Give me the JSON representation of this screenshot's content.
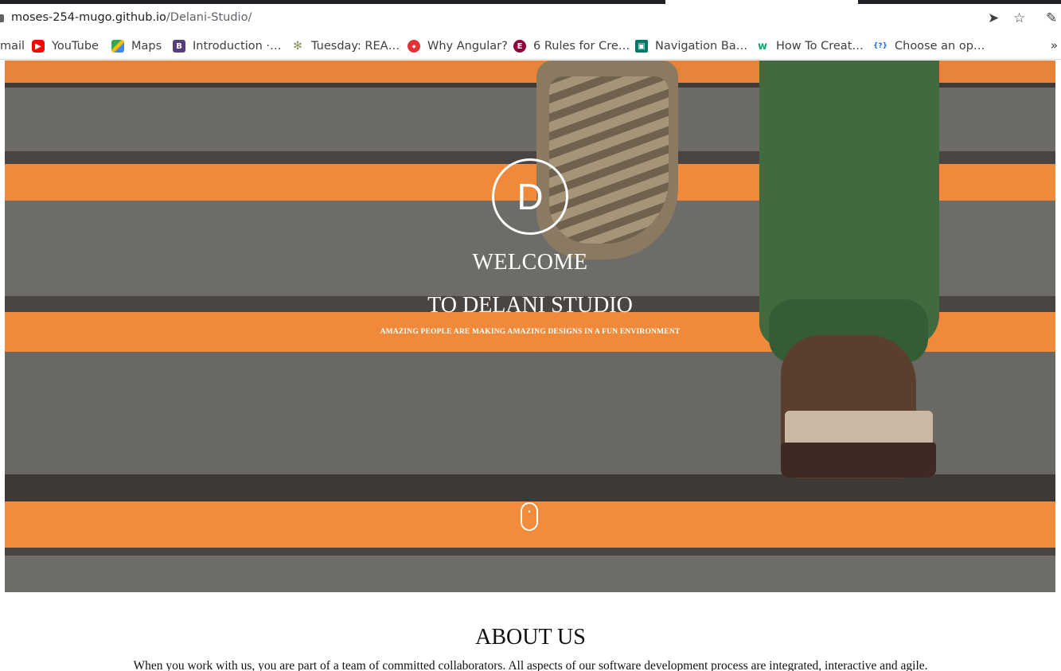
{
  "browser": {
    "url_host": "moses-254-mugo.github.io",
    "url_path": "/Delani-Studio/",
    "bookmarks": [
      {
        "label": "mail",
        "icon": "gmail-icon"
      },
      {
        "label": "YouTube",
        "icon": "youtube-icon",
        "color": "#ff0000"
      },
      {
        "label": "Maps",
        "icon": "maps-icon",
        "color": "#34a853"
      },
      {
        "label": "Introduction ·…",
        "icon": "bootstrap-icon",
        "color": "#563d7c"
      },
      {
        "label": "Tuesday: REA…",
        "icon": "tree-icon",
        "color": "#8a8f5a"
      },
      {
        "label": "Why Angular?",
        "icon": "angular-icon",
        "color": "#e23237"
      },
      {
        "label": "6 Rules for Cre…",
        "icon": "elementor-icon",
        "color": "#92003b"
      },
      {
        "label": "Navigation Ba…",
        "icon": "bookmark-icon",
        "color": "#00796b"
      },
      {
        "label": "How To Creat…",
        "icon": "w3-icon",
        "color": "#04aa6d"
      },
      {
        "label": "Choose an op…",
        "icon": "code-brackets-icon",
        "color": "#1a73e8"
      }
    ]
  },
  "hero": {
    "logo_letter": "D",
    "welcome": "WELCOME",
    "subtitle": "TO DELANI STUDIO",
    "tagline": "AMAZING PEOPLE ARE MAKING AMAZING DESIGNS IN A FUN ENVIRONMENT"
  },
  "about": {
    "title": "ABOUT US",
    "text": "When you work with us, you are part of a team of committed collaborators. All aspects of our software development process are integrated, interactive and agile."
  },
  "colors": {
    "stripe_orange": "#f08a3a",
    "step_gray": "#6b6a66",
    "pants_green": "#3f6b3e"
  }
}
